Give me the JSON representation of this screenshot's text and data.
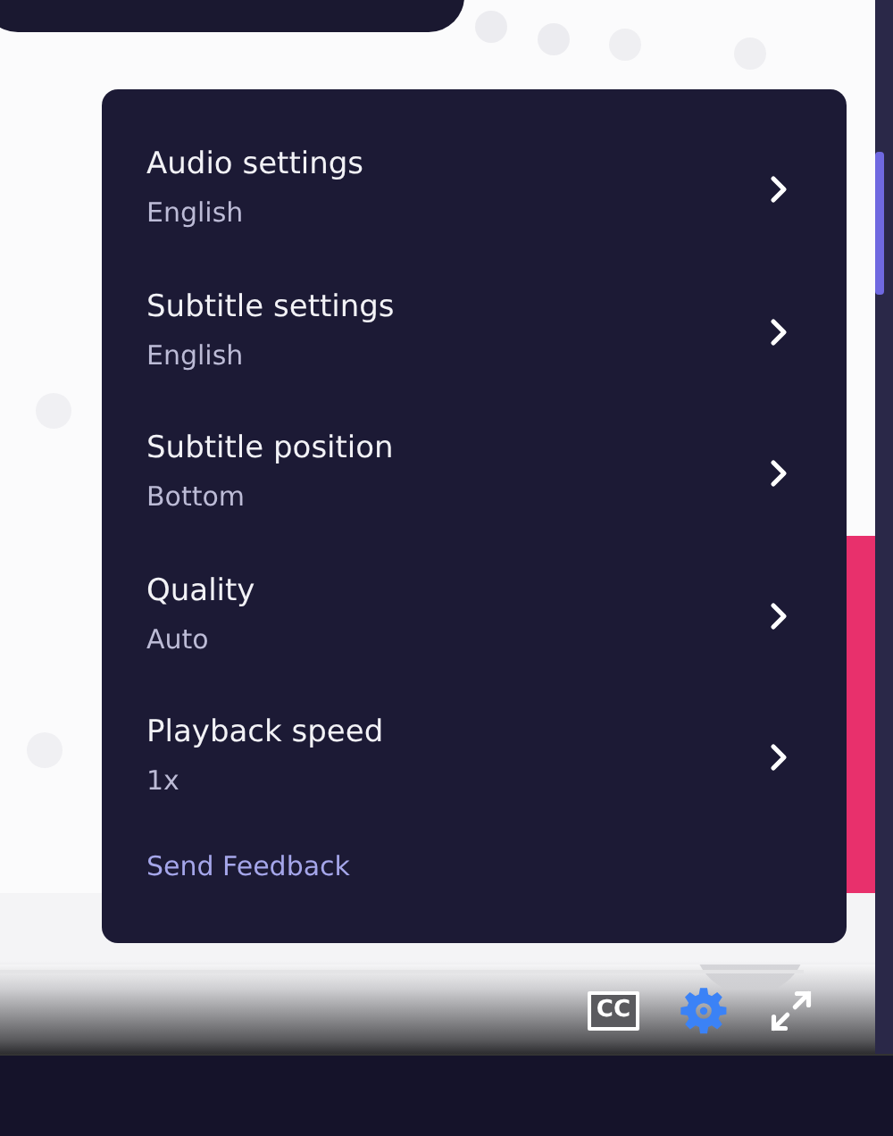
{
  "settings_menu": {
    "items": [
      {
        "title": "Audio settings",
        "value": "English"
      },
      {
        "title": "Subtitle settings",
        "value": "English"
      },
      {
        "title": "Subtitle position",
        "value": "Bottom"
      },
      {
        "title": "Quality",
        "value": "Auto"
      },
      {
        "title": "Playback speed",
        "value": "1x"
      }
    ],
    "feedback_link": "Send Feedback"
  },
  "controls": [
    {
      "kind": "cc",
      "label": "CC",
      "active": false
    },
    {
      "kind": "settings",
      "active": true
    },
    {
      "kind": "fullscreen",
      "active": false
    }
  ]
}
